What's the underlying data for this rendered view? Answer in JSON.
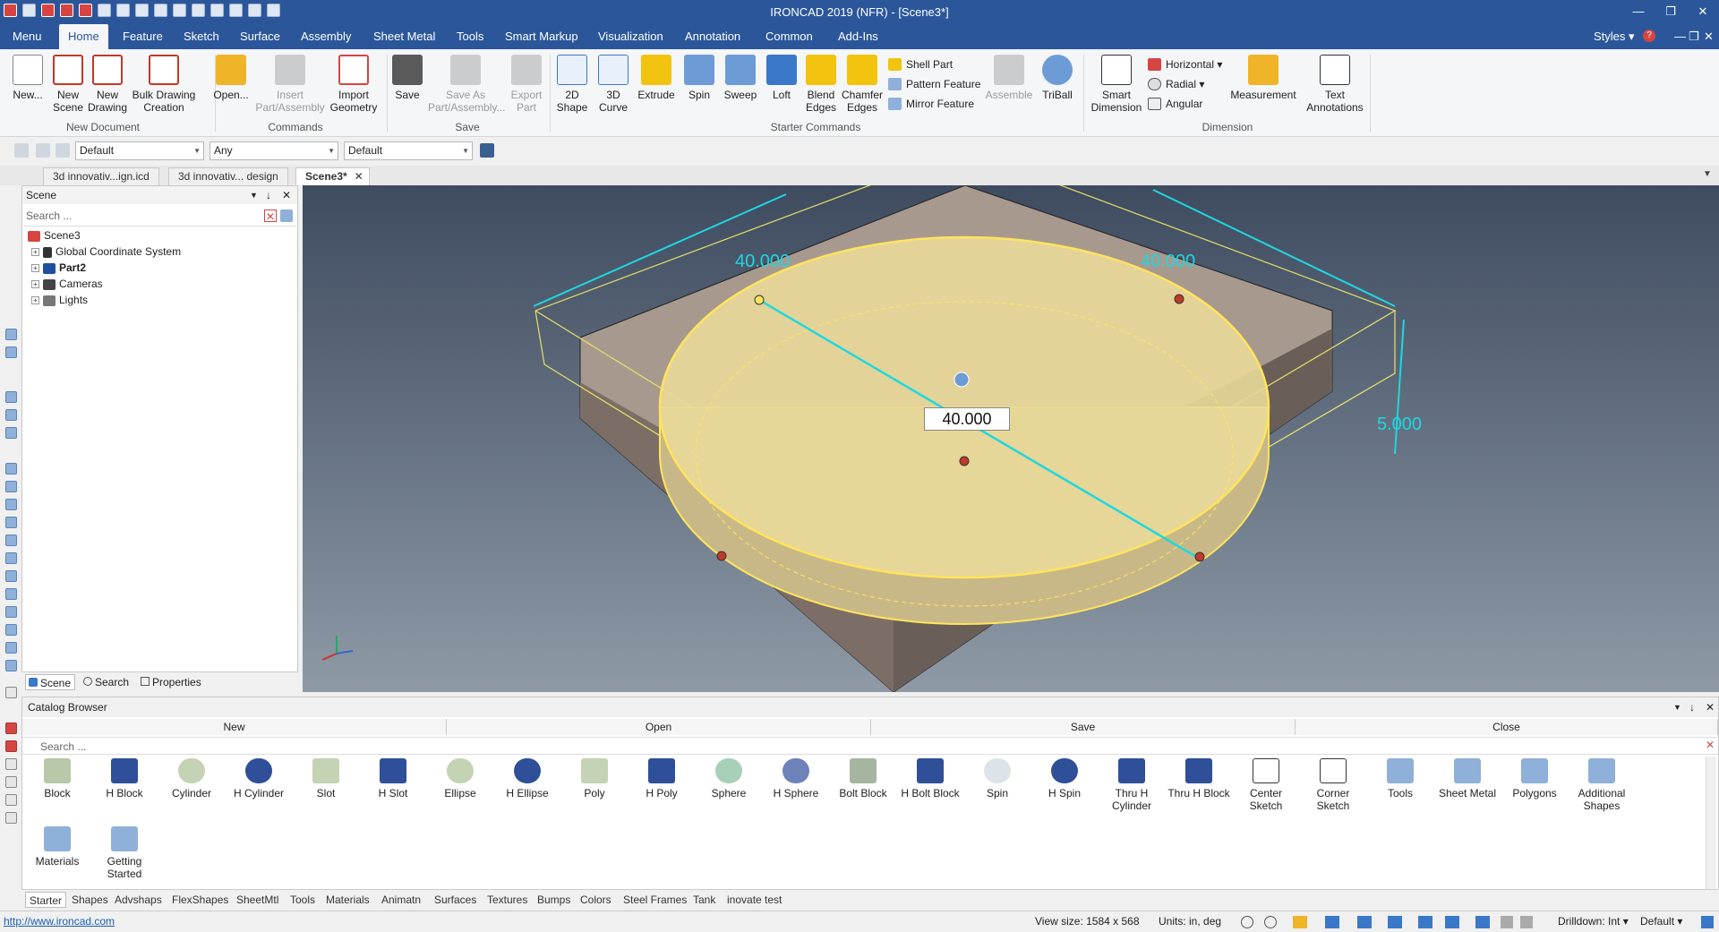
{
  "window": {
    "title": "IRONCAD 2019 (NFR) - [Scene3*]"
  },
  "ribbon_tabs": [
    "Menu",
    "Home",
    "Feature",
    "Sketch",
    "Surface",
    "Assembly",
    "Sheet Metal",
    "Tools",
    "Smart Markup",
    "Visualization",
    "Annotation",
    "Common",
    "Add-Ins"
  ],
  "styles_label": "Styles",
  "groups": {
    "new_document": {
      "label": "New Document",
      "buttons": [
        "New...",
        "New Scene",
        "New Drawing",
        "Bulk Drawing Creation"
      ]
    },
    "commands": {
      "label": "Commands",
      "buttons": [
        "Open...",
        "Insert Part/Assembly",
        "Import Geometry"
      ]
    },
    "save": {
      "label": "Save",
      "buttons": [
        "Save",
        "Save As Part/Assembly...",
        "Export Part"
      ]
    },
    "starter": {
      "label": "Starter Commands",
      "buttons": [
        "2D Shape",
        "3D Curve",
        "Extrude",
        "Spin",
        "Sweep",
        "Loft",
        "Blend Edges",
        "Chamfer Edges"
      ],
      "small": [
        "Shell Part",
        "Pattern Feature",
        "Mirror Feature"
      ],
      "more": [
        "Assemble",
        "TriBall"
      ]
    },
    "dimension": {
      "label": "Dimension",
      "buttons": [
        "Smart Dimension",
        "Measurement",
        "Text Annotations"
      ],
      "small": [
        "Horizontal",
        "Radial",
        "Angular"
      ]
    }
  },
  "toolbar": {
    "combo1": "Default",
    "combo2": "Any",
    "combo3": "Default"
  },
  "doc_tabs": [
    "3d innovativ...ign.icd",
    "3d innovativ... design",
    "Scene3*"
  ],
  "scene_panel": {
    "title": "Scene",
    "search_placeholder": "Search ...",
    "tree": [
      "Scene3",
      "Global Coordinate System",
      "Part2",
      "Cameras",
      "Lights"
    ],
    "tabs": [
      "Scene",
      "Search",
      "Properties"
    ]
  },
  "viewport": {
    "dim_left": "40.000",
    "dim_right": "40.000",
    "dim_height": "5.000",
    "dim_input": "40.000"
  },
  "catalog": {
    "title": "Catalog Browser",
    "actions": [
      "New",
      "Open",
      "Save",
      "Close"
    ],
    "search_placeholder": "Search ...",
    "items": [
      "Block",
      "H Block",
      "Cylinder",
      "H Cylinder",
      "Slot",
      "H Slot",
      "Ellipse",
      "H Ellipse",
      "Poly",
      "H Poly",
      "Sphere",
      "H Sphere",
      "Bolt Block",
      "H Bolt Block",
      "Spin",
      "H Spin",
      "Thru H Cylinder",
      "Thru H Block",
      "Center Sketch",
      "Corner Sketch",
      "Tools",
      "Sheet Metal",
      "Polygons",
      "Additional Shapes",
      "Materials",
      "Getting Started"
    ],
    "tabs": [
      "Starter",
      "Shapes",
      "Advshaps",
      "FlexShapes",
      "SheetMtl",
      "Tools",
      "Materials",
      "Animatn",
      "Surfaces",
      "Textures",
      "Bumps",
      "Colors",
      "Steel Frames",
      "Tank",
      "inovate test"
    ]
  },
  "status": {
    "link": "http://www.ironcad.com",
    "view_size": "View size: 1584 x  568",
    "units": "Units: in, deg",
    "drilldown": "Drilldown: Int",
    "style": "Default"
  }
}
